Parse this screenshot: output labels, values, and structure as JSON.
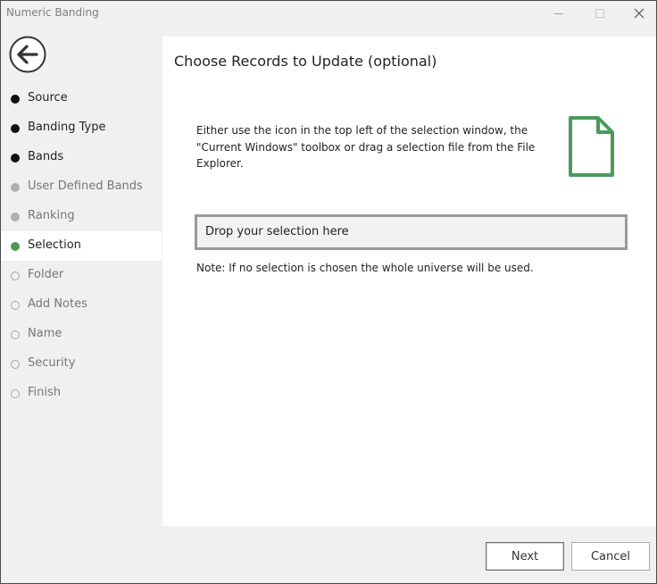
{
  "window": {
    "title": "Numeric Banding"
  },
  "sidebar": {
    "back_icon": "arrow-left-circle-icon",
    "steps": [
      {
        "label": "Source",
        "state": "done"
      },
      {
        "label": "Banding Type",
        "state": "done"
      },
      {
        "label": "Bands",
        "state": "done"
      },
      {
        "label": "User Defined Bands",
        "state": "skipped"
      },
      {
        "label": "Ranking",
        "state": "skipped"
      },
      {
        "label": "Selection",
        "state": "active"
      },
      {
        "label": "Folder",
        "state": "pending"
      },
      {
        "label": "Add Notes",
        "state": "pending"
      },
      {
        "label": "Name",
        "state": "pending"
      },
      {
        "label": "Security",
        "state": "pending"
      },
      {
        "label": "Finish",
        "state": "pending"
      }
    ]
  },
  "main": {
    "title": "Choose Records to Update (optional)",
    "instructions": "Either use the icon in the top left of the selection window, the \"Current Windows\" toolbox or drag a selection file from the File Explorer.",
    "file_icon": "document-icon",
    "drop_zone_text": "Drop your selection here",
    "note": "Note: If no selection is chosen the whole universe will be used."
  },
  "footer": {
    "next_label": "Next",
    "cancel_label": "Cancel"
  },
  "colors": {
    "accent_green": "#4a9a5a",
    "active_step_bg": "#ffffff",
    "chrome_bg": "#f0f0f0"
  }
}
